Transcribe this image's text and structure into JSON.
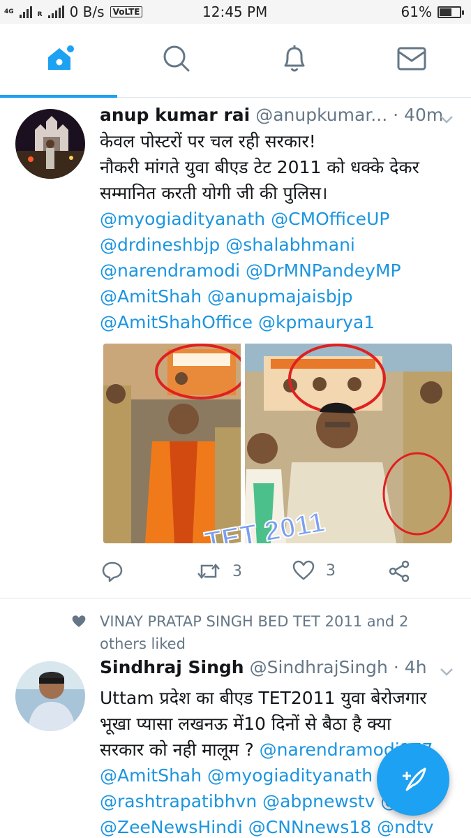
{
  "status_bar": {
    "network_top": "4G",
    "network_bottom": "R",
    "speed": "0 B/s",
    "volte": "VoLTE",
    "time": "12:45 PM",
    "battery": "61%",
    "battery_level": 0.61
  },
  "nav": {
    "active_tab": "home",
    "tabs": [
      "home",
      "search",
      "notifications",
      "messages"
    ]
  },
  "tweet1": {
    "name": "anup kumar rai",
    "handle": "@anupkumar...",
    "time": "· 40m",
    "lines": [
      "केवल पोस्टरों पर चल रही सरकार!",
      "नौकरी मांगते युवा बीएड टेट 2011 को धक्के देकर",
      "सम्मानित करती योगी जी की पुलिस।"
    ],
    "mention_lines": [
      "@myogiadityanath @CMOfficeUP",
      "@drdineshbjp @shalabhmani",
      "@narendramodi @DrMNPandeyMP",
      "@AmitShah @anupmajaisbjp",
      "@AmitShahOffice @kpmaurya1"
    ],
    "media_text": "TET 2011",
    "retweet_count": "3",
    "like_count": "3"
  },
  "social_context": {
    "line1": "VINAY PRATAP SINGH BED TET 2011 and 2",
    "line2": "others liked"
  },
  "tweet2": {
    "name": "Sindhraj Singh",
    "handle": "@SindhrajSingh",
    "time": "· 4h",
    "line1": "Uttam प्रदेश का बीएड TET2011 युवा बेरोजगार",
    "line2": "भूखा प्यासा लखनऊ में10 दिनों से बैठा है क्या",
    "line3_text": "सरकार को नही मालूम ? ",
    "line3_mention": "@narendramodi177",
    "mention_lines": [
      "@AmitShah @myogiadityanath",
      "@rashtrapatibhvn @abpnewstv @",
      "@ZeeNewsHindi @CNNnews18 @ndtv"
    ]
  },
  "colors": {
    "accent": "#1da1f2",
    "mention": "#1b95e0",
    "muted": "#657786"
  }
}
